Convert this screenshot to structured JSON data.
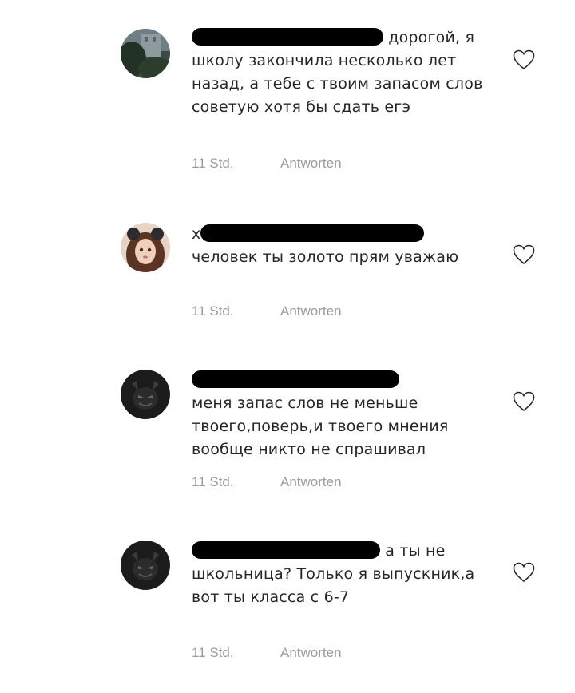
{
  "comments": [
    {
      "avatar_icon": "avatar-landscape",
      "username_redacted": true,
      "text": "дорогой, я школу закончила несколько лет назад, а тебе с твоим запасом слов советую хотя бы сдать егэ",
      "time": "11 Std.",
      "reply_label": "Antworten"
    },
    {
      "avatar_icon": "avatar-girl-filter",
      "username_prefix": "x",
      "username_redacted": true,
      "text": "человек ты золото прям уважаю",
      "time": "11 Std.",
      "reply_label": "Antworten"
    },
    {
      "avatar_icon": "avatar-dark-devil",
      "username_redacted": true,
      "text": "меня запас слов не меньше твоего,поверь,и твоего мнения вообще никто не спрашивал",
      "time": "11 Std.",
      "reply_label": "Antworten"
    },
    {
      "avatar_icon": "avatar-dark-devil",
      "username_redacted": true,
      "text": "а ты не школьница? Только я выпускник,а вот ты класса с 6-7",
      "time": "11 Std.",
      "reply_label": "Antworten"
    }
  ],
  "like_icon": "heart-outline-icon",
  "redaction_color": "#000000",
  "meta_color": "#9b9b9b",
  "text_color": "#262626"
}
